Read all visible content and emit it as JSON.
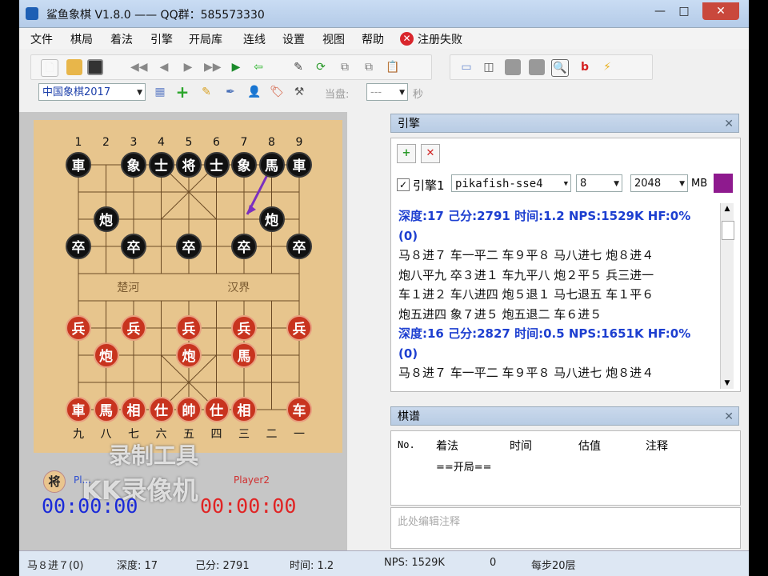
{
  "window": {
    "title": "鲨鱼象棋 V1.8.0 —— QQ群：585573330",
    "minimize": "—",
    "maximize": "□",
    "close": "✕"
  },
  "menu": [
    "文件",
    "棋局",
    "着法",
    "引擎",
    "开局库",
    "连线",
    "设置",
    "视图",
    "帮助"
  ],
  "register_status": "注册失败",
  "toolbar2": {
    "game_type": "中国象棋2017",
    "current_label": "当盘:",
    "time_value": "---",
    "time_unit": "秒"
  },
  "board": {
    "col_numbers_top": [
      "1",
      "2",
      "3",
      "4",
      "5",
      "6",
      "7",
      "8",
      "9"
    ],
    "col_numbers_bottom": [
      "九",
      "八",
      "七",
      "六",
      "五",
      "四",
      "三",
      "二",
      "一"
    ],
    "river_left": "楚河",
    "river_right": "汉界",
    "pieces": [
      {
        "t": "車",
        "c": "black",
        "col": 0,
        "row": 0
      },
      {
        "t": "象",
        "c": "black",
        "col": 2,
        "row": 0
      },
      {
        "t": "士",
        "c": "black",
        "col": 3,
        "row": 0
      },
      {
        "t": "将",
        "c": "black",
        "col": 4,
        "row": 0
      },
      {
        "t": "士",
        "c": "black",
        "col": 5,
        "row": 0
      },
      {
        "t": "象",
        "c": "black",
        "col": 6,
        "row": 0
      },
      {
        "t": "馬",
        "c": "black",
        "col": 7,
        "row": 0
      },
      {
        "t": "車",
        "c": "black",
        "col": 8,
        "row": 0
      },
      {
        "t": "炮",
        "c": "black",
        "col": 1,
        "row": 2
      },
      {
        "t": "炮",
        "c": "black",
        "col": 7,
        "row": 2
      },
      {
        "t": "卒",
        "c": "black",
        "col": 0,
        "row": 3
      },
      {
        "t": "卒",
        "c": "black",
        "col": 2,
        "row": 3
      },
      {
        "t": "卒",
        "c": "black",
        "col": 4,
        "row": 3
      },
      {
        "t": "卒",
        "c": "black",
        "col": 6,
        "row": 3
      },
      {
        "t": "卒",
        "c": "black",
        "col": 8,
        "row": 3
      },
      {
        "t": "兵",
        "c": "red",
        "col": 0,
        "row": 6
      },
      {
        "t": "兵",
        "c": "red",
        "col": 2,
        "row": 6
      },
      {
        "t": "兵",
        "c": "red",
        "col": 4,
        "row": 6
      },
      {
        "t": "兵",
        "c": "red",
        "col": 6,
        "row": 6
      },
      {
        "t": "兵",
        "c": "red",
        "col": 8,
        "row": 6
      },
      {
        "t": "炮",
        "c": "red",
        "col": 1,
        "row": 7
      },
      {
        "t": "炮",
        "c": "red",
        "col": 4,
        "row": 7
      },
      {
        "t": "馬",
        "c": "red",
        "col": 6,
        "row": 7
      },
      {
        "t": "車",
        "c": "red",
        "col": 0,
        "row": 9
      },
      {
        "t": "馬",
        "c": "red",
        "col": 1,
        "row": 9
      },
      {
        "t": "相",
        "c": "red",
        "col": 2,
        "row": 9
      },
      {
        "t": "仕",
        "c": "red",
        "col": 3,
        "row": 9
      },
      {
        "t": "帥",
        "c": "red",
        "col": 4,
        "row": 9
      },
      {
        "t": "仕",
        "c": "red",
        "col": 5,
        "row": 9
      },
      {
        "t": "相",
        "c": "red",
        "col": 6,
        "row": 9
      },
      {
        "t": "车",
        "c": "red",
        "col": 8,
        "row": 9
      }
    ],
    "arrow_color": "#7b2fbf"
  },
  "watermark": {
    "line1": "录制工具",
    "line2": "KK录像机"
  },
  "players": {
    "black_icon": "将",
    "player1": "Pl...",
    "player2": "Player2",
    "clock1": "00:00:00",
    "clock2": "00:00:00",
    "clock1_color": "#1a2ad8",
    "clock2_color": "#e02424"
  },
  "engine_panel": {
    "title": "引擎",
    "engine_label": "引擎1",
    "engine_name": "pikafish-sse4",
    "threads": "8",
    "hash": "2048",
    "hash_unit": "MB",
    "lines": [
      {
        "hdr": true,
        "text": "深度:17  己分:2791  时间:1.2  NPS:1529K  HF:0%"
      },
      {
        "hdr": true,
        "text": "(0)"
      },
      {
        "hdr": false,
        "text": "马８进７ 车一平二 车９平８ 马八进七 炮８进４"
      },
      {
        "hdr": false,
        "text": "炮八平九 卒３进１ 车九平八 炮２平５ 兵三进一"
      },
      {
        "hdr": false,
        "text": "车１进２ 车八进四 炮５退１ 马七退五 车１平６"
      },
      {
        "hdr": false,
        "text": "炮五进四 象７进５ 炮五退二 车６进５"
      },
      {
        "hdr": true,
        "text": "深度:16  己分:2827  时间:0.5  NPS:1651K  HF:0%"
      },
      {
        "hdr": true,
        "text": "(0)"
      },
      {
        "hdr": false,
        "text": "马８进７ 车一平二 车９平８ 马八进七 炮８进４"
      }
    ]
  },
  "record_panel": {
    "title": "棋谱",
    "columns": [
      "No.",
      "着法",
      "时间",
      "估值",
      "注释"
    ],
    "rows": [
      "==开局=="
    ],
    "comment_placeholder": "此处编辑注释"
  },
  "status": {
    "move": "马８进７(0)",
    "depth": "深度: 17",
    "score": "己分: 2791",
    "time": "时间: 1.2",
    "nps": "NPS: 1529K",
    "zero": "0",
    "per_step": "每步20层"
  }
}
